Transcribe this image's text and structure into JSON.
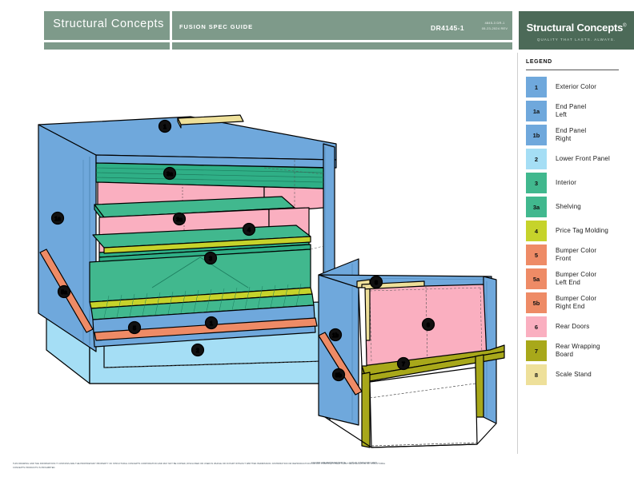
{
  "header": {
    "company": "Structural Concepts",
    "guide": "FUSION SPEC GUIDE",
    "drawing_number": "DR4145-1",
    "meta_line1": "4845-3 DR-1",
    "meta_line2": "05-23-2024 REV",
    "logo_name": "Structural Concepts",
    "logo_tm": "®",
    "logo_tagline": "QUALITY THAT LASTS. ALWAYS."
  },
  "legend": {
    "title": "LEGEND",
    "items": [
      {
        "code": "1",
        "label": "Exterior Color",
        "color": "#6FA8DC"
      },
      {
        "code": "1a",
        "label": "End Panel\nLeft",
        "color": "#6FA8DC"
      },
      {
        "code": "1b",
        "label": "End Panel\nRight",
        "color": "#6FA8DC"
      },
      {
        "code": "2",
        "label": "Lower Front Panel",
        "color": "#A5DEF5"
      },
      {
        "code": "3",
        "label": "Interior",
        "color": "#41B88E"
      },
      {
        "code": "3a",
        "label": "Shelving",
        "color": "#41B88E"
      },
      {
        "code": "4",
        "label": "Price Tag Molding",
        "color": "#C6D32B"
      },
      {
        "code": "5",
        "label": "Bumper Color\nFront",
        "color": "#EE8B66"
      },
      {
        "code": "5a",
        "label": "Bumper Color\nLeft End",
        "color": "#EE8B66"
      },
      {
        "code": "5b",
        "label": "Bumper Color\nRight End",
        "color": "#EE8B66"
      },
      {
        "code": "6",
        "label": "Rear Doors",
        "color": "#FAAFC0"
      },
      {
        "code": "7",
        "label": "Rear Wrapping\nBoard",
        "color": "#A8A81A"
      },
      {
        "code": "8",
        "label": "Scale Stand",
        "color": "#EEE09A"
      }
    ]
  },
  "drawings": {
    "front_view_callouts": [
      "1",
      "3a",
      "1a",
      "3a",
      "3",
      "4",
      "5a",
      "5",
      "1",
      "2"
    ],
    "rear_view_callouts": [
      "8",
      "6",
      "1b",
      "5b",
      "7"
    ]
  },
  "footer": {
    "disclaimer": "THIS DRAWING AND THE INFORMATION IT CONTAINS ARE THE PROPRIETARY PROPERTY OF STRUCTURAL CONCEPTS CORPORATION AND MAY NOT BE COPIED, DISCLOSED OR USED IN WHOLE OR IN PART WITHOUT WRITTEN PERMISSION. DISTRIBUTION OR REPRODUCTION FOR ANY PURPOSE OTHER THAN THE EVALUATION OF STRUCTURAL CONCEPTS PRODUCTS IS PROHIBITED.",
    "right_note": "COLORS ARE REPRESENTATIVE — ACTUAL FINISH MAY VARY"
  },
  "colors": {
    "header_green": "#7E9A8A",
    "logo_green": "#4C6A58",
    "exterior_blue": "#6FA8DC",
    "lower_panel_blue": "#A5DEF5",
    "interior_green": "#41B88E",
    "molding_yellow": "#C6D32B",
    "bumper_orange": "#EE8B66",
    "door_pink": "#FAAFC0",
    "board_olive": "#A8A81A",
    "scale_cream": "#EEE09A",
    "outline": "#000000"
  }
}
